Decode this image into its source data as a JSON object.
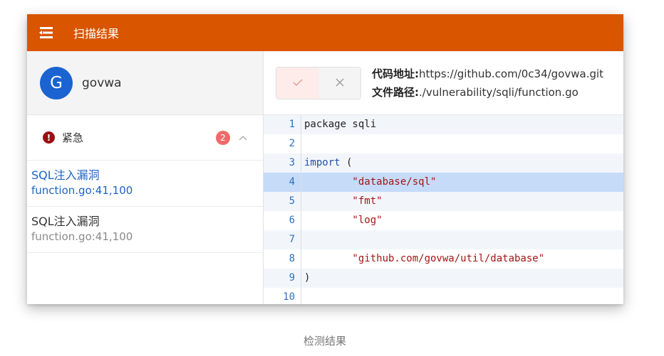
{
  "colors": {
    "appbar": "#d95500",
    "avatar": "#1a63d1",
    "severity_urgent": "#9b0d12",
    "badge": "#ef6a6a",
    "active_link": "#1e63c4",
    "highlight_line": "#c5dbf8"
  },
  "appbar": {
    "menu_icon": "menu-icon",
    "title": "扫描结果"
  },
  "user": {
    "avatar_letter": "G",
    "name": "govwa"
  },
  "group": {
    "icon": "exclamation-circle-icon",
    "label": "紧急",
    "count": "2",
    "expanded": true
  },
  "vulns": [
    {
      "title": "SQL注入漏洞",
      "location": "function.go:41,100",
      "active": true
    },
    {
      "title": "SQL注入漏洞",
      "location": "function.go:41,100",
      "active": false
    }
  ],
  "actions": {
    "confirm_icon": "check-icon",
    "reject_icon": "close-icon"
  },
  "meta": {
    "repo_label": "代码地址:",
    "repo_value": "https://github.com/0c34/govwa.git",
    "file_label": "文件路径:",
    "file_value": "./vulnerability/sqli/function.go"
  },
  "code": {
    "highlight_line": 4,
    "lines": [
      {
        "n": "1",
        "text": "package sqli"
      },
      {
        "n": "2",
        "text": ""
      },
      {
        "n": "3",
        "text": "import ("
      },
      {
        "n": "4",
        "text": "        \"database/sql\""
      },
      {
        "n": "5",
        "text": "        \"fmt\""
      },
      {
        "n": "6",
        "text": "        \"log\""
      },
      {
        "n": "7",
        "text": ""
      },
      {
        "n": "8",
        "text": "        \"github.com/govwa/util/database\""
      },
      {
        "n": "9",
        "text": ")"
      },
      {
        "n": "10",
        "text": ""
      }
    ]
  },
  "caption": "检测结果"
}
